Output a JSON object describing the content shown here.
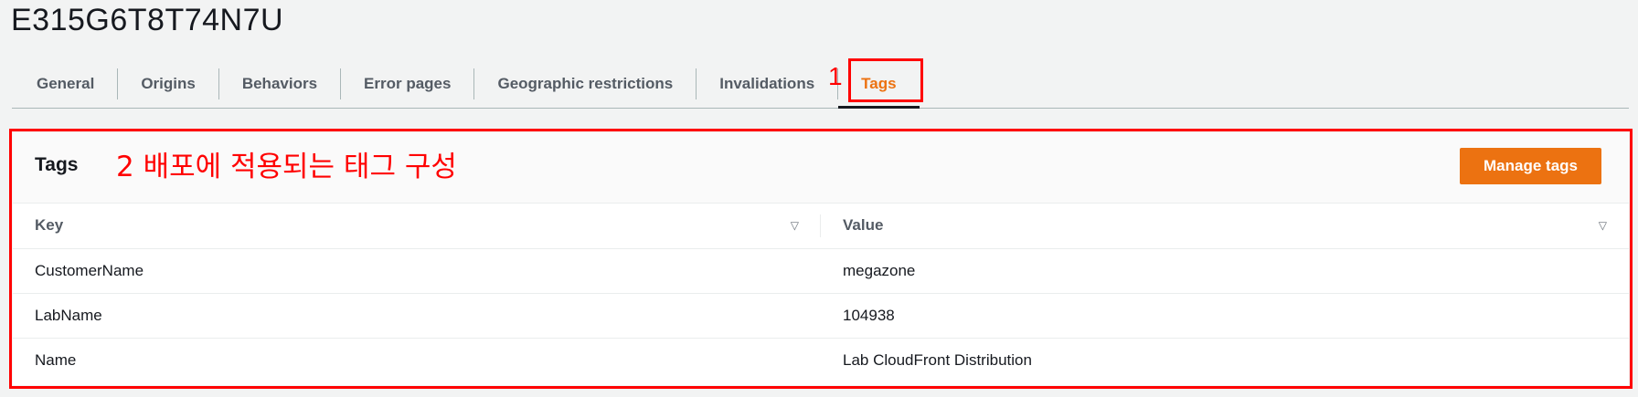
{
  "page": {
    "title": "E315G6T8T74N7U"
  },
  "tabs": [
    {
      "label": "General",
      "active": false
    },
    {
      "label": "Origins",
      "active": false
    },
    {
      "label": "Behaviors",
      "active": false
    },
    {
      "label": "Error pages",
      "active": false
    },
    {
      "label": "Geographic restrictions",
      "active": false
    },
    {
      "label": "Invalidations",
      "active": false
    },
    {
      "label": "Tags",
      "active": true
    }
  ],
  "annotations": {
    "step1": "1",
    "step2": "2 배포에 적용되는 태그 구성",
    "color": "#ff0000"
  },
  "panel": {
    "title": "Tags",
    "manage_button": "Manage tags"
  },
  "table": {
    "columns": [
      "Key",
      "Value"
    ],
    "rows": [
      {
        "key": "CustomerName",
        "value": "megazone"
      },
      {
        "key": "LabName",
        "value": "104938"
      },
      {
        "key": "Name",
        "value": "Lab CloudFront Distribution"
      }
    ]
  },
  "colors": {
    "accent": "#ec7211",
    "background": "#f2f3f3"
  },
  "icons": {
    "sort": "caret-down-outline-icon"
  }
}
